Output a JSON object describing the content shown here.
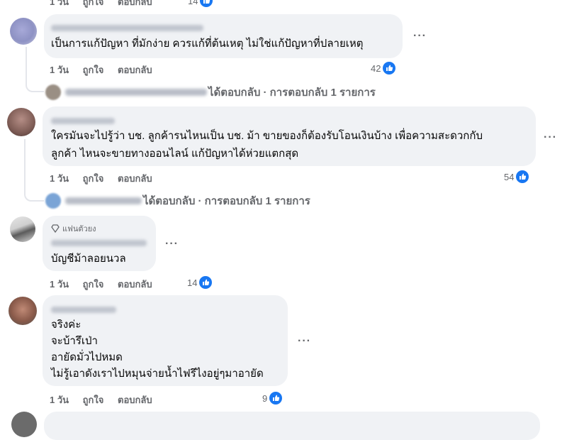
{
  "labels": {
    "time": "1 วัน",
    "like": "ถูกใจ",
    "reply": "ตอบกลับ",
    "more": "···"
  },
  "top_partial": {
    "count": "14"
  },
  "comments": [
    {
      "text_lines": [
        "เป็นการแก้ปัญหา ที่มักง่าย ควรแก้ที่ต้นเหตุ ไม่ใช่แก้ปัญหาที่ปลายเหตุ"
      ],
      "reactions": "42",
      "replies_summary": "ได้ตอบกลับ · การตอบกลับ 1 รายการ"
    },
    {
      "text_lines": [
        "ใครมันจะไปรู้ว่า บช. ลูกค้ารนไหนเป็น บช. ม้า ขายของก็ต้องรับโอนเงินบ้าง เพื่อความสะดวกกับ",
        "ลูกค้า ไหนจะขายทางออนไลน์ แก้ปัญหาได้ห่วยแตกสุด"
      ],
      "reactions": "54",
      "replies_summary": "ได้ตอบกลับ · การตอบกลับ 1 รายการ"
    },
    {
      "badge": "แฟนตัวยง",
      "text_lines": [
        "บัญชีม้าลอยนวล"
      ],
      "reactions": "14"
    },
    {
      "text_lines": [
        "จริงค่ะ",
        "จะบ้ารึเป่า",
        "อายัดมั่วไปหมด",
        "ไม่รู้เอาดังเราไปหมุนจ่ายน้ำไฟรึไงอยู่ๆมาอายัด"
      ],
      "reactions": "9"
    }
  ],
  "colors": {
    "bubble": "#f0f2f5",
    "secondary_text": "#65676b",
    "like_blue": "#1877f2"
  }
}
